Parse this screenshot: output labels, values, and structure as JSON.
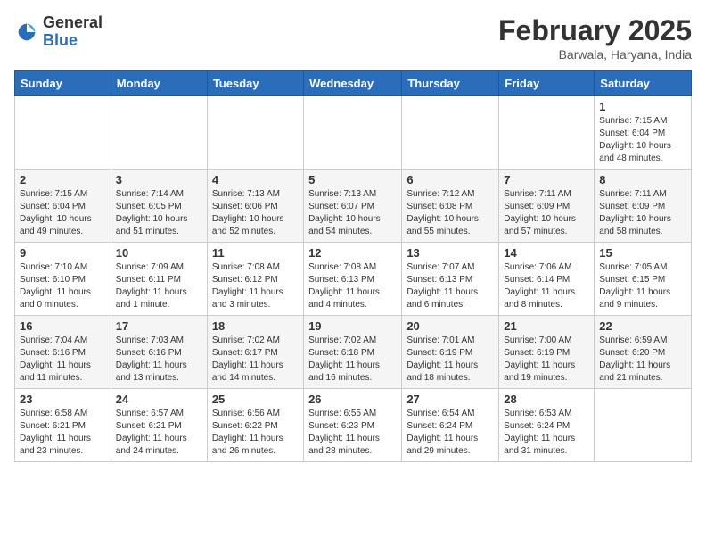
{
  "logo": {
    "general": "General",
    "blue": "Blue"
  },
  "title": "February 2025",
  "location": "Barwala, Haryana, India",
  "weekdays": [
    "Sunday",
    "Monday",
    "Tuesday",
    "Wednesday",
    "Thursday",
    "Friday",
    "Saturday"
  ],
  "weeks": [
    [
      {
        "day": "",
        "text": ""
      },
      {
        "day": "",
        "text": ""
      },
      {
        "day": "",
        "text": ""
      },
      {
        "day": "",
        "text": ""
      },
      {
        "day": "",
        "text": ""
      },
      {
        "day": "",
        "text": ""
      },
      {
        "day": "1",
        "text": "Sunrise: 7:15 AM\nSunset: 6:04 PM\nDaylight: 10 hours and 48 minutes."
      }
    ],
    [
      {
        "day": "2",
        "text": "Sunrise: 7:15 AM\nSunset: 6:04 PM\nDaylight: 10 hours and 49 minutes."
      },
      {
        "day": "3",
        "text": "Sunrise: 7:14 AM\nSunset: 6:05 PM\nDaylight: 10 hours and 51 minutes."
      },
      {
        "day": "4",
        "text": "Sunrise: 7:13 AM\nSunset: 6:06 PM\nDaylight: 10 hours and 52 minutes."
      },
      {
        "day": "5",
        "text": "Sunrise: 7:13 AM\nSunset: 6:07 PM\nDaylight: 10 hours and 54 minutes."
      },
      {
        "day": "6",
        "text": "Sunrise: 7:12 AM\nSunset: 6:08 PM\nDaylight: 10 hours and 55 minutes."
      },
      {
        "day": "7",
        "text": "Sunrise: 7:11 AM\nSunset: 6:09 PM\nDaylight: 10 hours and 57 minutes."
      },
      {
        "day": "8",
        "text": "Sunrise: 7:11 AM\nSunset: 6:09 PM\nDaylight: 10 hours and 58 minutes."
      }
    ],
    [
      {
        "day": "9",
        "text": "Sunrise: 7:10 AM\nSunset: 6:10 PM\nDaylight: 11 hours and 0 minutes."
      },
      {
        "day": "10",
        "text": "Sunrise: 7:09 AM\nSunset: 6:11 PM\nDaylight: 11 hours and 1 minute."
      },
      {
        "day": "11",
        "text": "Sunrise: 7:08 AM\nSunset: 6:12 PM\nDaylight: 11 hours and 3 minutes."
      },
      {
        "day": "12",
        "text": "Sunrise: 7:08 AM\nSunset: 6:13 PM\nDaylight: 11 hours and 4 minutes."
      },
      {
        "day": "13",
        "text": "Sunrise: 7:07 AM\nSunset: 6:13 PM\nDaylight: 11 hours and 6 minutes."
      },
      {
        "day": "14",
        "text": "Sunrise: 7:06 AM\nSunset: 6:14 PM\nDaylight: 11 hours and 8 minutes."
      },
      {
        "day": "15",
        "text": "Sunrise: 7:05 AM\nSunset: 6:15 PM\nDaylight: 11 hours and 9 minutes."
      }
    ],
    [
      {
        "day": "16",
        "text": "Sunrise: 7:04 AM\nSunset: 6:16 PM\nDaylight: 11 hours and 11 minutes."
      },
      {
        "day": "17",
        "text": "Sunrise: 7:03 AM\nSunset: 6:16 PM\nDaylight: 11 hours and 13 minutes."
      },
      {
        "day": "18",
        "text": "Sunrise: 7:02 AM\nSunset: 6:17 PM\nDaylight: 11 hours and 14 minutes."
      },
      {
        "day": "19",
        "text": "Sunrise: 7:02 AM\nSunset: 6:18 PM\nDaylight: 11 hours and 16 minutes."
      },
      {
        "day": "20",
        "text": "Sunrise: 7:01 AM\nSunset: 6:19 PM\nDaylight: 11 hours and 18 minutes."
      },
      {
        "day": "21",
        "text": "Sunrise: 7:00 AM\nSunset: 6:19 PM\nDaylight: 11 hours and 19 minutes."
      },
      {
        "day": "22",
        "text": "Sunrise: 6:59 AM\nSunset: 6:20 PM\nDaylight: 11 hours and 21 minutes."
      }
    ],
    [
      {
        "day": "23",
        "text": "Sunrise: 6:58 AM\nSunset: 6:21 PM\nDaylight: 11 hours and 23 minutes."
      },
      {
        "day": "24",
        "text": "Sunrise: 6:57 AM\nSunset: 6:21 PM\nDaylight: 11 hours and 24 minutes."
      },
      {
        "day": "25",
        "text": "Sunrise: 6:56 AM\nSunset: 6:22 PM\nDaylight: 11 hours and 26 minutes."
      },
      {
        "day": "26",
        "text": "Sunrise: 6:55 AM\nSunset: 6:23 PM\nDaylight: 11 hours and 28 minutes."
      },
      {
        "day": "27",
        "text": "Sunrise: 6:54 AM\nSunset: 6:24 PM\nDaylight: 11 hours and 29 minutes."
      },
      {
        "day": "28",
        "text": "Sunrise: 6:53 AM\nSunset: 6:24 PM\nDaylight: 11 hours and 31 minutes."
      },
      {
        "day": "",
        "text": ""
      }
    ]
  ]
}
